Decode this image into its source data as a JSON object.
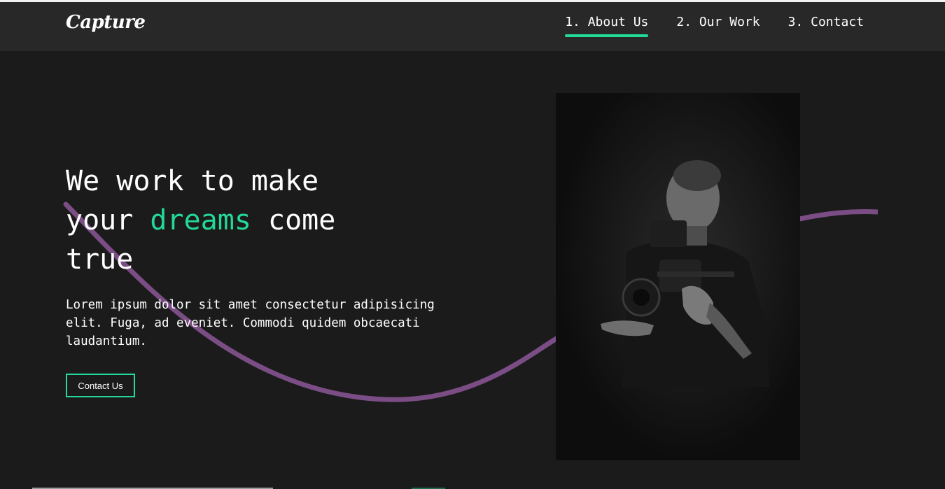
{
  "brand": {
    "logo_text": "Capture"
  },
  "nav": {
    "items": [
      {
        "label": "1. About Us",
        "active": true
      },
      {
        "label": "2. Our Work",
        "active": false
      },
      {
        "label": "3. Contact",
        "active": false
      }
    ]
  },
  "hero": {
    "headline_line1": "We work to make",
    "headline_your": "your",
    "headline_accent": "dreams",
    "headline_come": "come",
    "headline_true": "true",
    "description": "Lorem ipsum dolor sit amet consectetur adipisicing elit. Fuga, ad eveniet. Commodi quidem obcaecati laudantium.",
    "cta_label": "Contact Us"
  },
  "colors": {
    "background": "#1b1b1b",
    "navbar": "#282828",
    "accent": "#23d997",
    "wave": "#7b4d85"
  },
  "icons": {
    "decoration": "wave-line-decoration",
    "image": "photographer-with-camera-image"
  }
}
